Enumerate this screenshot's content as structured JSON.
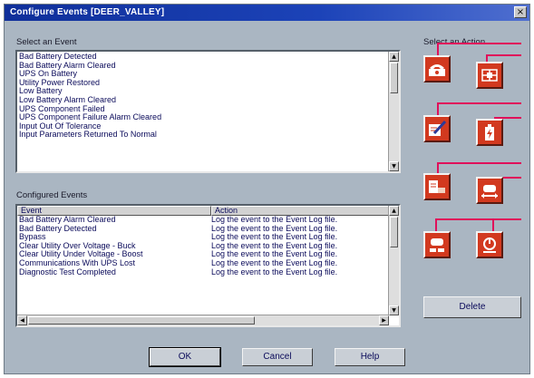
{
  "window": {
    "title": "Configure Events [DEER_VALLEY]",
    "close_glyph": "×"
  },
  "select_event": {
    "label": "Select an Event",
    "items": [
      "Bad Battery Detected",
      "Bad Battery Alarm Cleared",
      "UPS On Battery",
      "Utility Power Restored",
      "Low Battery",
      "Low Battery Alarm Cleared",
      "UPS Component Failed",
      "UPS Component Failure Alarm Cleared",
      "Input Out Of Tolerance",
      "Input Parameters Returned To Normal"
    ]
  },
  "configured_events": {
    "label": "Configured Events",
    "columns": [
      "Event",
      "Action"
    ],
    "rows": [
      [
        "Bad Battery Alarm Cleared",
        "Log the event to the Event Log file."
      ],
      [
        "Bad Battery Detected",
        "Log the event to the Event Log file."
      ],
      [
        "Bypass",
        "Log the event to the Event Log file."
      ],
      [
        "Clear Utility Over Voltage - Buck",
        "Log the event to the Event Log file."
      ],
      [
        "Clear Utility Under Voltage - Boost",
        "Log the event to the Event Log file."
      ],
      [
        "Communications With UPS Lost",
        "Log the event to the Event Log file."
      ],
      [
        "Diagnostic Test Completed",
        "Log the event to the Event Log file."
      ]
    ]
  },
  "select_action": {
    "label": "Select an Action",
    "icons": [
      "phone-call-icon",
      "network-grid-icon",
      "message-pencil-icon",
      "battery-bolt-icon",
      "gavel-log-icon",
      "broadcast-message-icon",
      "shutdown-message-icon",
      "power-off-icon"
    ],
    "connector_color": "#e0105a",
    "button_color": "#d2391f"
  },
  "buttons": {
    "delete": "Delete",
    "ok": "OK",
    "cancel": "Cancel",
    "help": "Help"
  }
}
